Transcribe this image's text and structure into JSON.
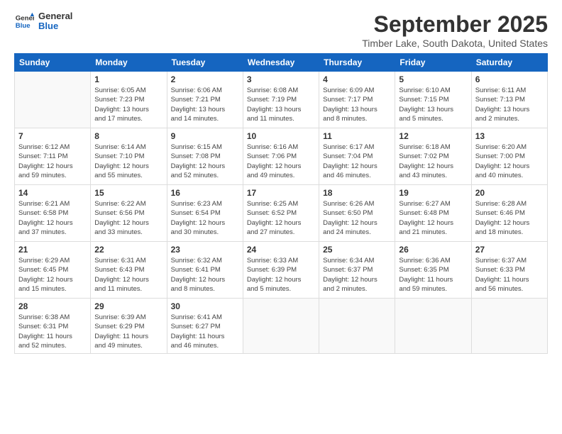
{
  "logo": {
    "line1": "General",
    "line2": "Blue"
  },
  "title": "September 2025",
  "location": "Timber Lake, South Dakota, United States",
  "weekdays": [
    "Sunday",
    "Monday",
    "Tuesday",
    "Wednesday",
    "Thursday",
    "Friday",
    "Saturday"
  ],
  "weeks": [
    [
      {
        "day": "",
        "info": ""
      },
      {
        "day": "1",
        "info": "Sunrise: 6:05 AM\nSunset: 7:23 PM\nDaylight: 13 hours\nand 17 minutes."
      },
      {
        "day": "2",
        "info": "Sunrise: 6:06 AM\nSunset: 7:21 PM\nDaylight: 13 hours\nand 14 minutes."
      },
      {
        "day": "3",
        "info": "Sunrise: 6:08 AM\nSunset: 7:19 PM\nDaylight: 13 hours\nand 11 minutes."
      },
      {
        "day": "4",
        "info": "Sunrise: 6:09 AM\nSunset: 7:17 PM\nDaylight: 13 hours\nand 8 minutes."
      },
      {
        "day": "5",
        "info": "Sunrise: 6:10 AM\nSunset: 7:15 PM\nDaylight: 13 hours\nand 5 minutes."
      },
      {
        "day": "6",
        "info": "Sunrise: 6:11 AM\nSunset: 7:13 PM\nDaylight: 13 hours\nand 2 minutes."
      }
    ],
    [
      {
        "day": "7",
        "info": "Sunrise: 6:12 AM\nSunset: 7:11 PM\nDaylight: 12 hours\nand 59 minutes."
      },
      {
        "day": "8",
        "info": "Sunrise: 6:14 AM\nSunset: 7:10 PM\nDaylight: 12 hours\nand 55 minutes."
      },
      {
        "day": "9",
        "info": "Sunrise: 6:15 AM\nSunset: 7:08 PM\nDaylight: 12 hours\nand 52 minutes."
      },
      {
        "day": "10",
        "info": "Sunrise: 6:16 AM\nSunset: 7:06 PM\nDaylight: 12 hours\nand 49 minutes."
      },
      {
        "day": "11",
        "info": "Sunrise: 6:17 AM\nSunset: 7:04 PM\nDaylight: 12 hours\nand 46 minutes."
      },
      {
        "day": "12",
        "info": "Sunrise: 6:18 AM\nSunset: 7:02 PM\nDaylight: 12 hours\nand 43 minutes."
      },
      {
        "day": "13",
        "info": "Sunrise: 6:20 AM\nSunset: 7:00 PM\nDaylight: 12 hours\nand 40 minutes."
      }
    ],
    [
      {
        "day": "14",
        "info": "Sunrise: 6:21 AM\nSunset: 6:58 PM\nDaylight: 12 hours\nand 37 minutes."
      },
      {
        "day": "15",
        "info": "Sunrise: 6:22 AM\nSunset: 6:56 PM\nDaylight: 12 hours\nand 33 minutes."
      },
      {
        "day": "16",
        "info": "Sunrise: 6:23 AM\nSunset: 6:54 PM\nDaylight: 12 hours\nand 30 minutes."
      },
      {
        "day": "17",
        "info": "Sunrise: 6:25 AM\nSunset: 6:52 PM\nDaylight: 12 hours\nand 27 minutes."
      },
      {
        "day": "18",
        "info": "Sunrise: 6:26 AM\nSunset: 6:50 PM\nDaylight: 12 hours\nand 24 minutes."
      },
      {
        "day": "19",
        "info": "Sunrise: 6:27 AM\nSunset: 6:48 PM\nDaylight: 12 hours\nand 21 minutes."
      },
      {
        "day": "20",
        "info": "Sunrise: 6:28 AM\nSunset: 6:46 PM\nDaylight: 12 hours\nand 18 minutes."
      }
    ],
    [
      {
        "day": "21",
        "info": "Sunrise: 6:29 AM\nSunset: 6:45 PM\nDaylight: 12 hours\nand 15 minutes."
      },
      {
        "day": "22",
        "info": "Sunrise: 6:31 AM\nSunset: 6:43 PM\nDaylight: 12 hours\nand 11 minutes."
      },
      {
        "day": "23",
        "info": "Sunrise: 6:32 AM\nSunset: 6:41 PM\nDaylight: 12 hours\nand 8 minutes."
      },
      {
        "day": "24",
        "info": "Sunrise: 6:33 AM\nSunset: 6:39 PM\nDaylight: 12 hours\nand 5 minutes."
      },
      {
        "day": "25",
        "info": "Sunrise: 6:34 AM\nSunset: 6:37 PM\nDaylight: 12 hours\nand 2 minutes."
      },
      {
        "day": "26",
        "info": "Sunrise: 6:36 AM\nSunset: 6:35 PM\nDaylight: 11 hours\nand 59 minutes."
      },
      {
        "day": "27",
        "info": "Sunrise: 6:37 AM\nSunset: 6:33 PM\nDaylight: 11 hours\nand 56 minutes."
      }
    ],
    [
      {
        "day": "28",
        "info": "Sunrise: 6:38 AM\nSunset: 6:31 PM\nDaylight: 11 hours\nand 52 minutes."
      },
      {
        "day": "29",
        "info": "Sunrise: 6:39 AM\nSunset: 6:29 PM\nDaylight: 11 hours\nand 49 minutes."
      },
      {
        "day": "30",
        "info": "Sunrise: 6:41 AM\nSunset: 6:27 PM\nDaylight: 11 hours\nand 46 minutes."
      },
      {
        "day": "",
        "info": ""
      },
      {
        "day": "",
        "info": ""
      },
      {
        "day": "",
        "info": ""
      },
      {
        "day": "",
        "info": ""
      }
    ]
  ]
}
